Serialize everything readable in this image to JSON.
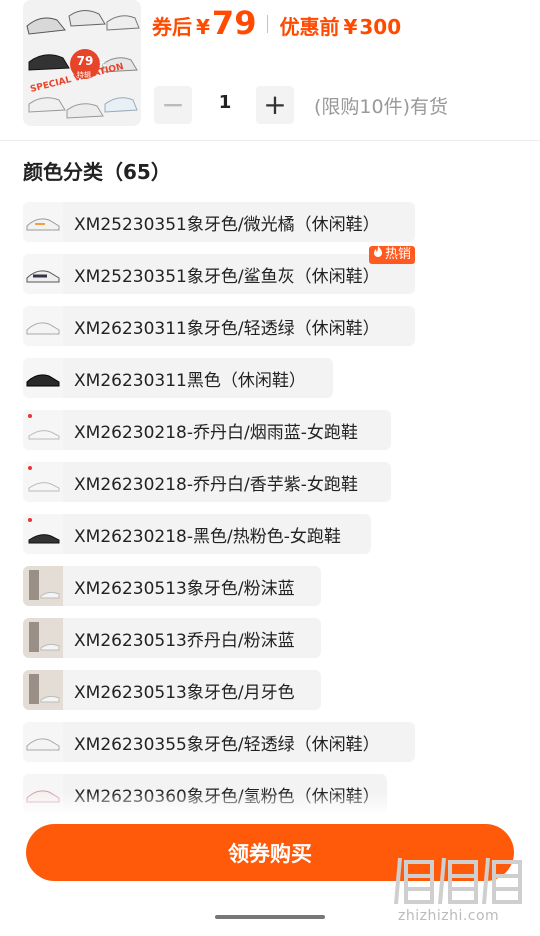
{
  "product": {
    "coupon_price_label": "券后",
    "currency": "¥",
    "coupon_price": "79",
    "original_price_label": "优惠前",
    "original_price": "300",
    "thumb_badge_price": "79",
    "thumb_badge_unit": "元",
    "thumb_badge_sub": "特辑",
    "thumb_banner": "SPECIAL VACATION"
  },
  "quantity": {
    "decrement_label": "−",
    "value": "1",
    "increment_label": "+",
    "stock_note": "(限购10件)有货"
  },
  "colors": {
    "title": "颜色分类（65）",
    "hot_badge_text": "热销",
    "options": [
      {
        "label": "XM25230351象牙色/微光橘（休闲鞋）",
        "icon": "white-orange-sneaker-icon"
      },
      {
        "label": "XM25230351象牙色/鲨鱼灰（休闲鞋）",
        "icon": "white-gray-sneaker-icon",
        "badge": "热销"
      },
      {
        "label": "XM26230311象牙色/轻透绿（休闲鞋）",
        "icon": "white-sneaker-icon"
      },
      {
        "label": "XM26230311黑色（休闲鞋）",
        "icon": "black-sneaker-icon"
      },
      {
        "label": "XM26230218-乔丹白/烟雨蓝-女跑鞋",
        "icon": "white-running-shoe-icon"
      },
      {
        "label": "XM26230218-乔丹白/香芋紫-女跑鞋",
        "icon": "white-running-shoe-icon"
      },
      {
        "label": "XM26230218-黑色/热粉色-女跑鞋",
        "icon": "black-running-shoe-icon"
      },
      {
        "label": "XM26230513象牙色/粉沫蓝",
        "icon": "model-photo-icon"
      },
      {
        "label": "XM26230513乔丹白/粉沫蓝",
        "icon": "model-photo-icon"
      },
      {
        "label": "XM26230513象牙色/月牙色",
        "icon": "model-photo-icon"
      },
      {
        "label": "XM26230355象牙色/轻透绿（休闲鞋）",
        "icon": "white-sneaker-icon"
      },
      {
        "label": "XM26230360象牙色/氢粉色（休闲鞋）",
        "icon": "white-pink-sneaker-icon"
      }
    ]
  },
  "actions": {
    "buy_label": "领券购买"
  },
  "watermark": {
    "text": "zhizhizhi.com"
  },
  "colors_theme": {
    "accent": "#ff5a0a",
    "price": "#ff4a00",
    "chip_bg": "#f3f3f3"
  }
}
